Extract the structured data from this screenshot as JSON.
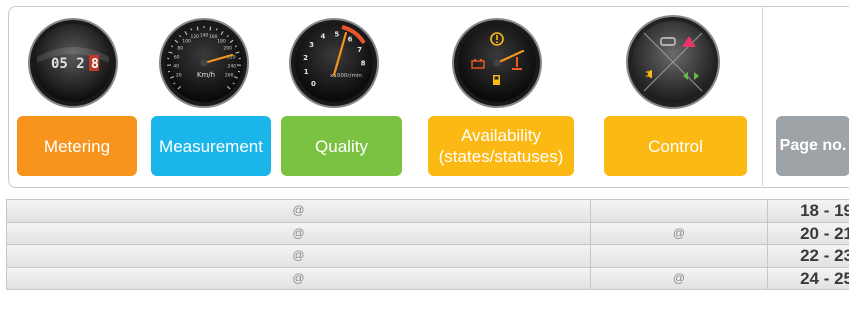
{
  "header": {
    "labels": [
      {
        "text": "Metering",
        "color": "#f7941d"
      },
      {
        "text": "Measurement",
        "color": "#1ab6ea"
      },
      {
        "text": "Quality",
        "color": "#7cc242"
      },
      {
        "text": "Availability (states/statuses)",
        "color": "#fdb913"
      },
      {
        "text": "Control",
        "color": "#fdb913"
      }
    ],
    "page_label": "Page no.",
    "gauges": {
      "odometer": {
        "digits": "05 2",
        "last_digit": "8"
      },
      "speedometer": {
        "unit": "Km/h",
        "ticks": [
          "20",
          "40",
          "60",
          "80",
          "100",
          "120",
          "140",
          "160",
          "180",
          "200",
          "220",
          "240",
          "260"
        ]
      },
      "tachometer": {
        "unit": "x1000r/min",
        "ticks": [
          "0",
          "1",
          "2",
          "3",
          "4",
          "5",
          "6",
          "7",
          "8"
        ]
      },
      "warning_icons": [
        "engine-warning-icon",
        "battery-icon",
        "fuel-icon",
        "temperature-icon"
      ],
      "control_icons": [
        "car-icon",
        "hazard-triangle-icon",
        "headlight-icon",
        "turn-signal-icon"
      ]
    }
  },
  "rows": [
    {
      "col1": "@",
      "col2": "",
      "page": "18 - 19"
    },
    {
      "col1": "@",
      "col2": "@",
      "page": "20 - 21"
    },
    {
      "col1": "@",
      "col2": "",
      "page": "22 - 23"
    },
    {
      "col1": "@",
      "col2": "@",
      "page": "24 - 25"
    }
  ]
}
